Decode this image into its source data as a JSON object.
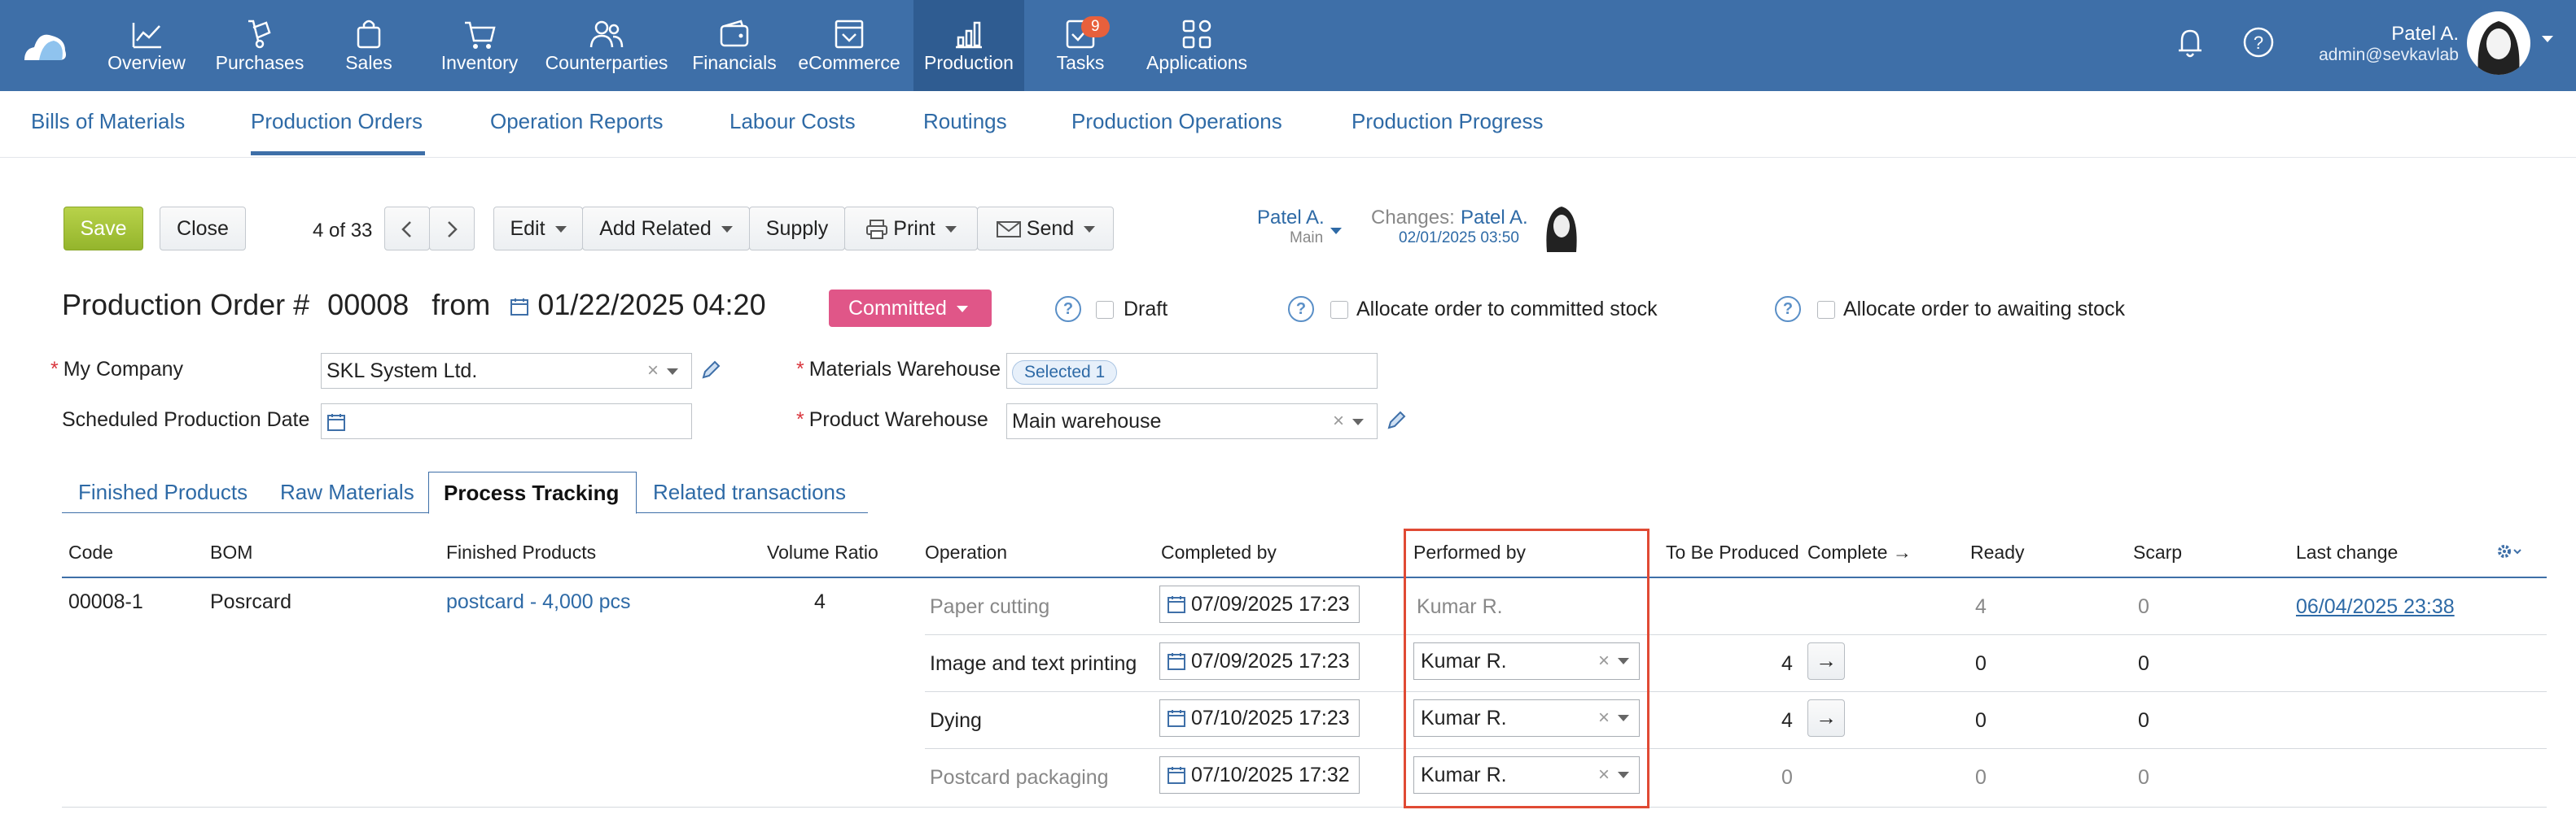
{
  "nav": {
    "items": [
      {
        "label": "Overview",
        "icon": "chart-line-icon"
      },
      {
        "label": "Purchases",
        "icon": "hand-truck-icon"
      },
      {
        "label": "Sales",
        "icon": "shopping-bag-icon"
      },
      {
        "label": "Inventory",
        "icon": "cart-icon"
      },
      {
        "label": "Counterparties",
        "icon": "people-icon"
      },
      {
        "label": "Financials",
        "icon": "wallet-icon"
      },
      {
        "label": "eCommerce",
        "icon": "storefront-icon"
      },
      {
        "label": "Production",
        "icon": "bar-chart-icon"
      },
      {
        "label": "Tasks",
        "icon": "checkbox-icon"
      },
      {
        "label": "Applications",
        "icon": "grid-icon"
      }
    ],
    "active": "Production",
    "tasks_badge": "9",
    "user_name": "Patel A.",
    "user_email": "admin@sevkavlab"
  },
  "subnav": {
    "items": [
      "Bills of Materials",
      "Production Orders",
      "Operation Reports",
      "Labour Costs",
      "Routings",
      "Production Operations",
      "Production Progress"
    ],
    "active": "Production Orders"
  },
  "toolbar": {
    "save": "Save",
    "close": "Close",
    "counter": "4 of 33",
    "edit": "Edit",
    "add_related": "Add Related",
    "supply": "Supply",
    "print": "Print",
    "send": "Send",
    "owner_name": "Patel A.",
    "owner_sub": "Main",
    "changes_label": "Changes:",
    "changes_name": "Patel A.",
    "changes_date": "02/01/2025 03:50"
  },
  "order": {
    "title_prefix": "Production Order #",
    "number": "00008",
    "from": "from",
    "date": "01/22/2025 04:20",
    "status": "Committed",
    "draft_label": "Draft",
    "alloc_committed_label": "Allocate order to committed stock",
    "alloc_awaiting_label": "Allocate order to awaiting stock"
  },
  "form": {
    "my_company_label": "My Company",
    "my_company_value": "SKL System Ltd.",
    "sched_date_label": "Scheduled Production Date",
    "sched_date_value": "",
    "materials_wh_label": "Materials Warehouse",
    "materials_wh_tag": "Selected 1",
    "product_wh_label": "Product Warehouse",
    "product_wh_value": "Main warehouse"
  },
  "tabs": [
    "Finished Products",
    "Raw Materials",
    "Process Tracking",
    "Related transactions"
  ],
  "tabs_active": "Process Tracking",
  "table": {
    "headers": [
      "Code",
      "BOM",
      "Finished Products",
      "Volume Ratio",
      "Operation",
      "Completed by",
      "Performed by",
      "To Be Produced",
      "Complete →",
      "Ready",
      "Scarp",
      "Last change"
    ],
    "code": "00008-1",
    "bom": "Posrcard",
    "finished_product": "postcard - 4,000 pcs",
    "volume_ratio": "4",
    "rows": [
      {
        "operation": "Paper cutting",
        "completed_by": "07/09/2025 17:23",
        "performed_by": "Kumar R.",
        "to_be_produced": "",
        "ready": "4",
        "scrap": "0",
        "last_change": "06/04/2025 23:38"
      },
      {
        "operation": "Image and text printing",
        "completed_by": "07/09/2025 17:23",
        "performed_by": "Kumar R.",
        "to_be_produced": "4",
        "ready": "0",
        "scrap": "0",
        "last_change": ""
      },
      {
        "operation": "Dying",
        "completed_by": "07/10/2025 17:23",
        "performed_by": "Kumar R.",
        "to_be_produced": "4",
        "ready": "0",
        "scrap": "0",
        "last_change": ""
      },
      {
        "operation": "Postcard packaging",
        "completed_by": "07/10/2025 17:32",
        "performed_by": "Kumar R.",
        "to_be_produced": "0",
        "ready": "0",
        "scrap": "0",
        "last_change": ""
      }
    ],
    "arrow": "→"
  },
  "colors": {
    "topbar": "#3e6fa8",
    "accent": "#2e6aa6",
    "status": "#e05688",
    "save": "#a5c33a",
    "highlight": "#e04a34"
  }
}
